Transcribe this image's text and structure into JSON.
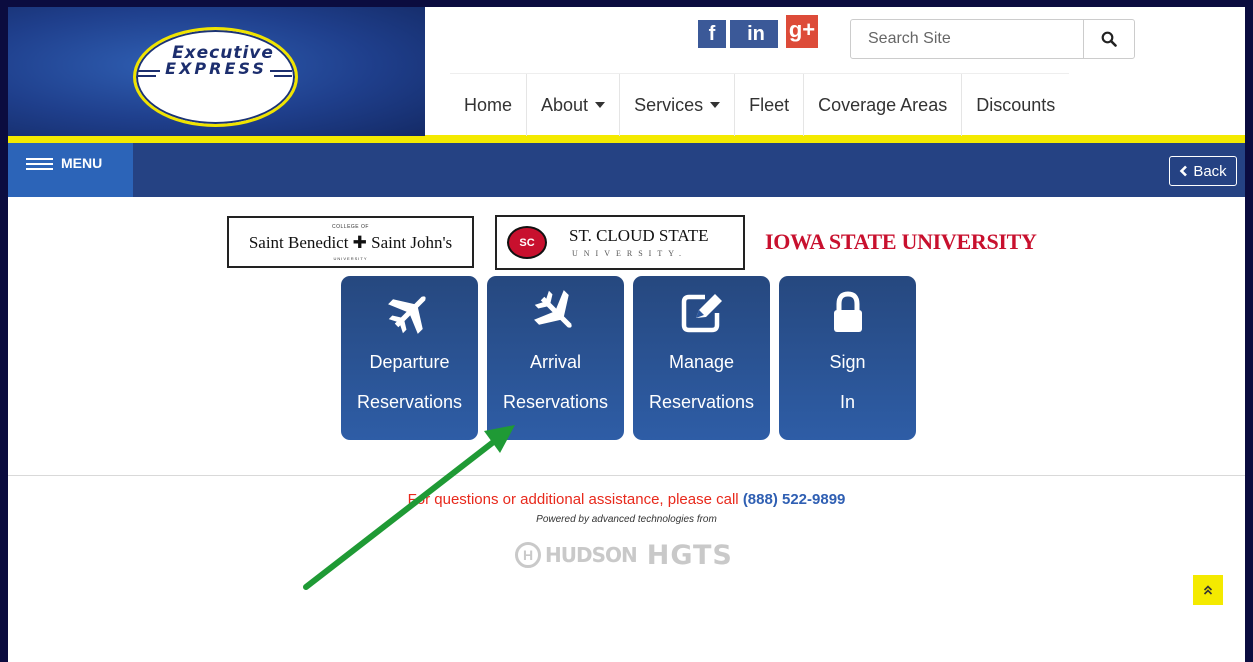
{
  "brand": {
    "logo_top": "Executive",
    "logo_bottom": "EXPRESS"
  },
  "social": {
    "facebook": "f",
    "linkedin": "in",
    "googleplus": "g+"
  },
  "search": {
    "placeholder": "Search Site"
  },
  "nav": [
    {
      "label": "Home",
      "dropdown": false
    },
    {
      "label": "About",
      "dropdown": true
    },
    {
      "label": "Services",
      "dropdown": true
    },
    {
      "label": "Fleet",
      "dropdown": false
    },
    {
      "label": "Coverage Areas",
      "dropdown": false
    },
    {
      "label": "Discounts",
      "dropdown": false
    }
  ],
  "menu_bar": {
    "menu_label": "MENU",
    "back_label": "Back"
  },
  "schools": {
    "sbsj_small": "COLLEGE OF",
    "sbsj_main": "Saint Benedict ✚ Saint John's",
    "sbsj_sub": "UNIVERSITY",
    "scsu_emblem": "SC",
    "scsu_main": "ST. CLOUD STATE",
    "scsu_sub": "UNIVERSITY.",
    "isu": "IOWA STATE UNIVERSITY"
  },
  "tiles": [
    {
      "line1": "Departure",
      "line2": "Reservations",
      "icon": "plane-departure-icon"
    },
    {
      "line1": "Arrival",
      "line2": "Reservations",
      "icon": "plane-arrival-icon"
    },
    {
      "line1": "Manage",
      "line2": "Reservations",
      "icon": "edit-icon"
    },
    {
      "line1": "Sign",
      "line2": "In",
      "icon": "lock-icon"
    }
  ],
  "footer": {
    "contact_text": "For questions or additional assistance, please call",
    "phone": "(888) 522-9899",
    "powered": "Powered by advanced technologies from",
    "hudson_h": "H",
    "hudson": "HUDSON",
    "hgts": "HGTS"
  },
  "colors": {
    "accent_blue": "#2c64b8",
    "menu_bar": "#254283",
    "highlight_yellow": "#f4ea00",
    "annotation_arrow": "#1f9a35"
  }
}
